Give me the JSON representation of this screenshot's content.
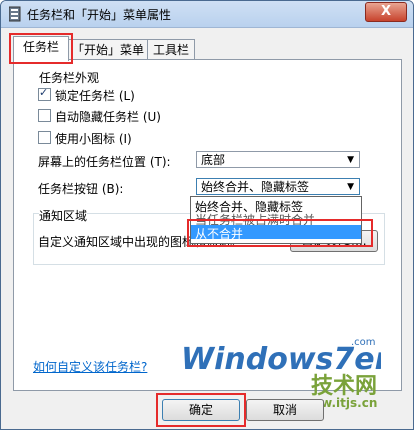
{
  "window": {
    "title": "任务栏和「开始」菜单属性",
    "close_label": "X"
  },
  "tabs": [
    {
      "label": "任务栏"
    },
    {
      "label": "「开始」菜单"
    },
    {
      "label": "工具栏"
    }
  ],
  "appearance": {
    "group_label": "任务栏外观",
    "checkboxes": [
      {
        "label": "锁定任务栏 (L)",
        "checked": true
      },
      {
        "label": "自动隐藏任务栏 (U)",
        "checked": false
      },
      {
        "label": "使用小图标 (I)",
        "checked": false
      }
    ],
    "position_label": "屏幕上的任务栏位置 (T):",
    "position_value": "底部",
    "buttons_label": "任务栏按钮 (B):",
    "buttons_value": "始终合并、隐藏标签"
  },
  "dropdown": {
    "options": [
      {
        "label": "始终合并、隐藏标签"
      },
      {
        "label": "当任务栏被占满时合并"
      },
      {
        "label": "从不合并",
        "highlighted": true
      }
    ]
  },
  "notification": {
    "group_label": "通知区域",
    "description": "自定义通知区域中出现的图标和通知。",
    "customize_button": "自定义(C)..."
  },
  "help_link": "如何自定义该任务栏?",
  "watermark": {
    "brand": "Windows7en",
    "site": "www.itjs.cn",
    "jishu": "技术网"
  },
  "footer": {
    "ok_label": "确定",
    "cancel_label": "取消"
  },
  "colors": {
    "highlight_box": "#e52b2b",
    "selection": "#3399ff",
    "link": "#0066cc",
    "watermark": "#7aa23a"
  }
}
